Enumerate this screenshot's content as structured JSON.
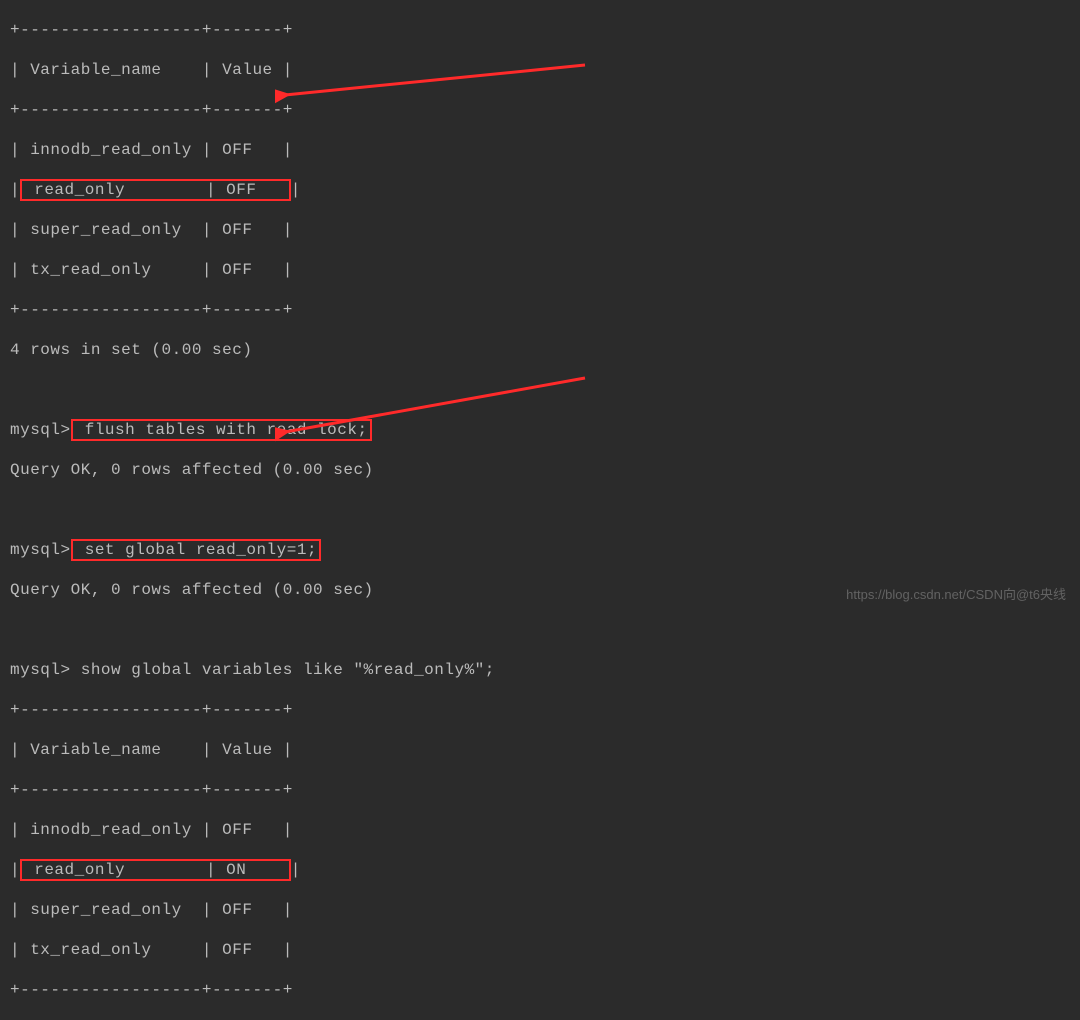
{
  "borderTop": "+------------------+-------+",
  "header": "| Variable_name    | Value |",
  "table1": {
    "rows": [
      "| innodb_read_only | OFF   |",
      "| super_read_only  | OFF   |",
      "| tx_read_only     | OFF   |"
    ],
    "hlRowLeft": " read_only        ",
    "hlRowRight": " OFF   "
  },
  "resultCount": "4 rows in set (0.00 sec)",
  "prompt": "mysql>",
  "cmd1": " flush tables with read lock;",
  "cmd2": " set global read_only=1;",
  "queryOk": "Query OK, 0 rows affected (0.00 sec)",
  "cmd3": " show global variables like \"%read_only%\";",
  "table2": {
    "rows": [
      "| innodb_read_only | OFF   |",
      "| super_read_only  | OFF   |",
      "| tx_read_only     | OFF   |"
    ],
    "hlRowLeft": " read_only        ",
    "hlRowRight": " ON    "
  },
  "pipe": "|",
  "watermark": "https://blog.csdn.net/CSDN向@t6央线"
}
